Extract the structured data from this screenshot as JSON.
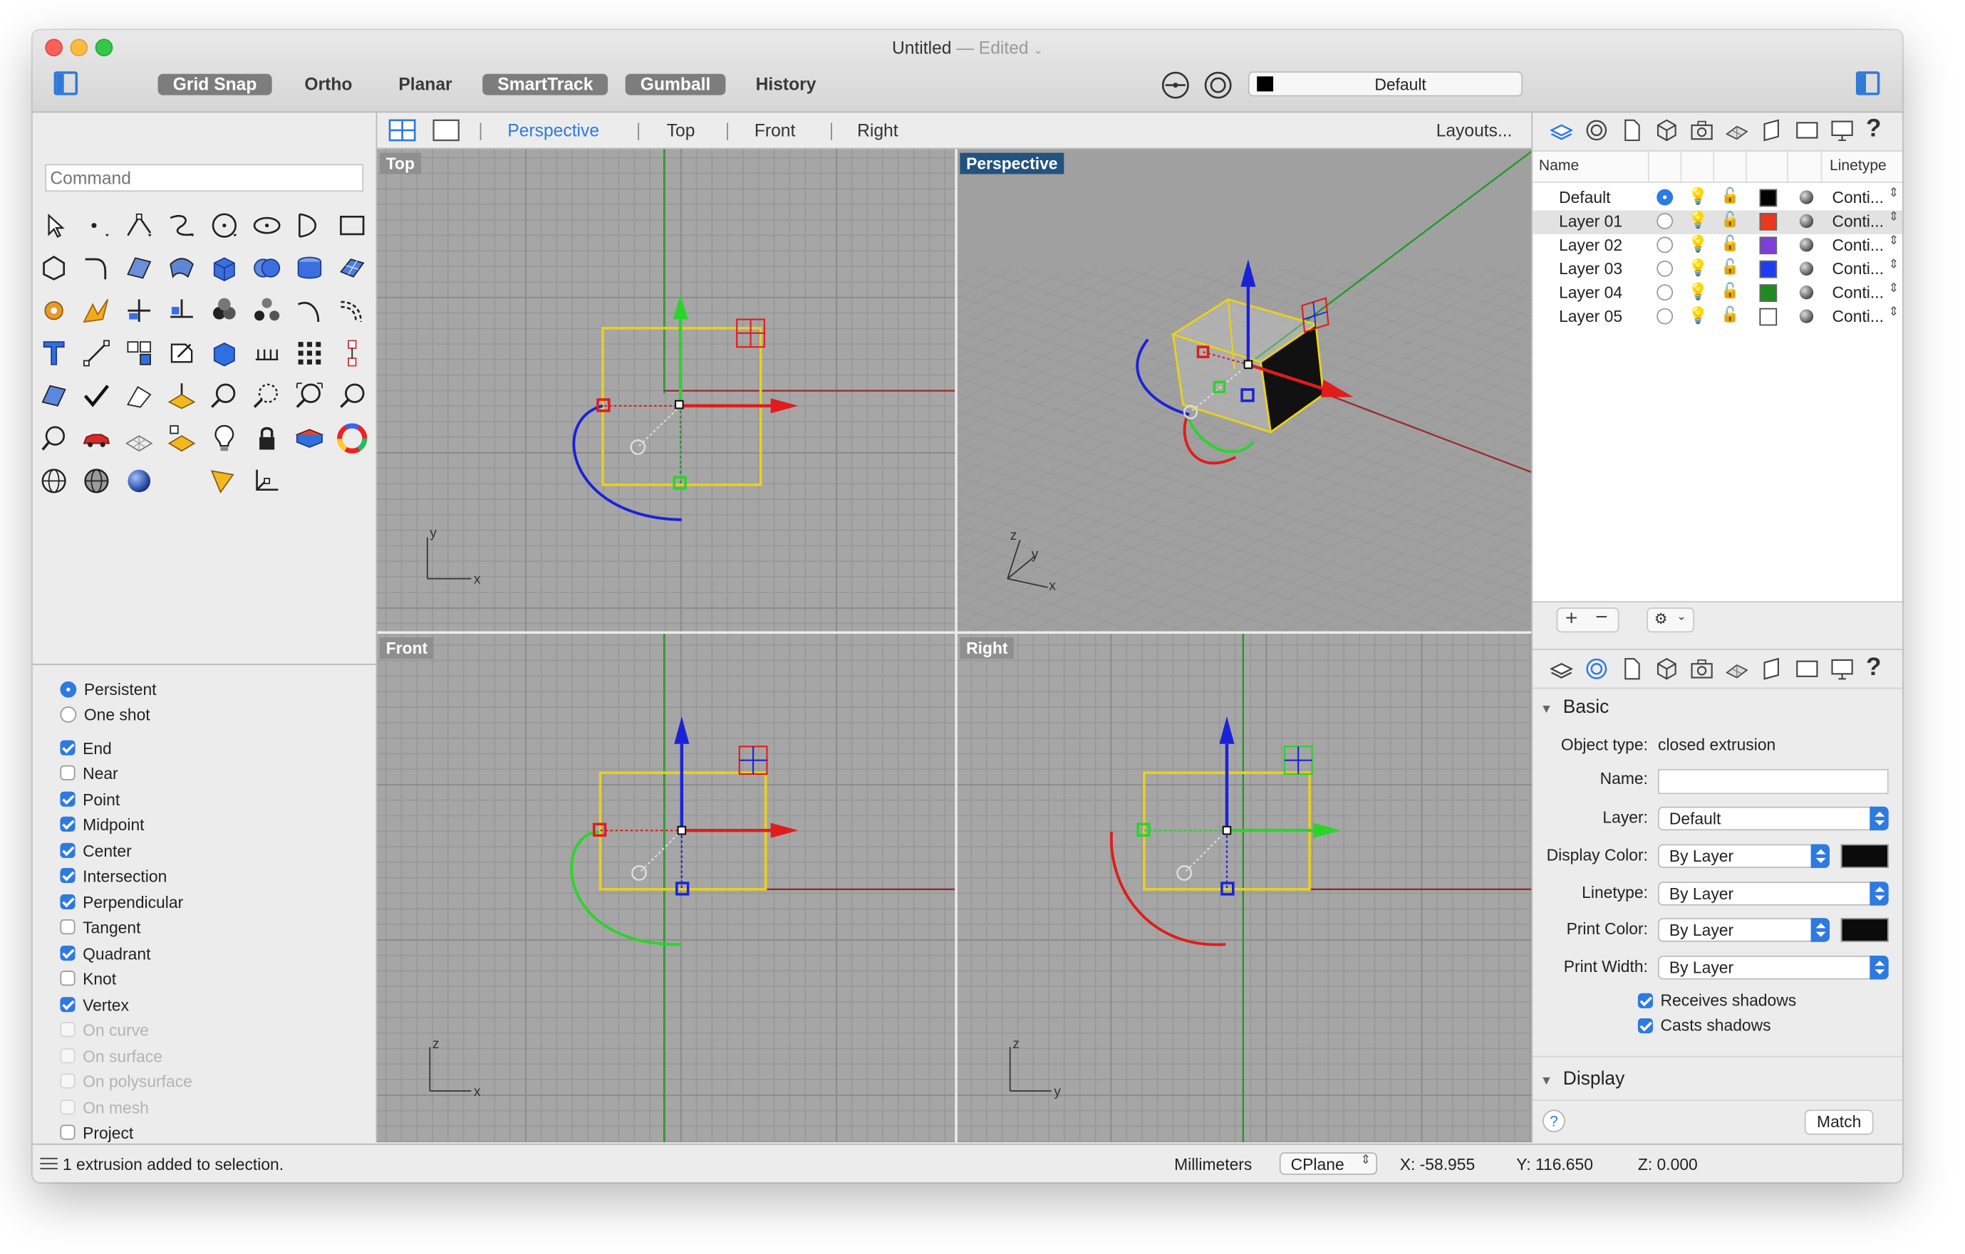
{
  "window": {
    "title": "Untitled",
    "edited": "— Edited"
  },
  "toolbar": {
    "grid_snap": "Grid Snap",
    "ortho": "Ortho",
    "planar": "Planar",
    "smarttrack": "SmartTrack",
    "gumball": "Gumball",
    "history": "History",
    "layer_default": "Default"
  },
  "command": {
    "placeholder": "Command"
  },
  "viewtabs": {
    "perspective": "Perspective",
    "top": "Top",
    "front": "Front",
    "right": "Right",
    "layouts": "Layouts..."
  },
  "viewports": {
    "top": {
      "label": "Top",
      "axis1": "y",
      "axis2": "x"
    },
    "perspective": {
      "label": "Perspective",
      "axis1": "z",
      "axis2": "y",
      "axis3": "x"
    },
    "front": {
      "label": "Front",
      "axis1": "z",
      "axis2": "x"
    },
    "right": {
      "label": "Right",
      "axis1": "z",
      "axis2": "y"
    }
  },
  "osnap": {
    "mode": [
      {
        "label": "Persistent",
        "selected": true
      },
      {
        "label": "One shot",
        "selected": false
      }
    ],
    "items": [
      {
        "label": "End",
        "checked": true,
        "enabled": true
      },
      {
        "label": "Near",
        "checked": false,
        "enabled": true
      },
      {
        "label": "Point",
        "checked": true,
        "enabled": true
      },
      {
        "label": "Midpoint",
        "checked": true,
        "enabled": true
      },
      {
        "label": "Center",
        "checked": true,
        "enabled": true
      },
      {
        "label": "Intersection",
        "checked": true,
        "enabled": true
      },
      {
        "label": "Perpendicular",
        "checked": true,
        "enabled": true
      },
      {
        "label": "Tangent",
        "checked": false,
        "enabled": true
      },
      {
        "label": "Quadrant",
        "checked": true,
        "enabled": true
      },
      {
        "label": "Knot",
        "checked": false,
        "enabled": true
      },
      {
        "label": "Vertex",
        "checked": true,
        "enabled": true
      },
      {
        "label": "On curve",
        "checked": false,
        "enabled": false
      },
      {
        "label": "On surface",
        "checked": false,
        "enabled": false
      },
      {
        "label": "On polysurface",
        "checked": false,
        "enabled": false
      },
      {
        "label": "On mesh",
        "checked": false,
        "enabled": false
      },
      {
        "label": "Project",
        "checked": false,
        "enabled": true
      }
    ]
  },
  "layers": {
    "header": {
      "name": "Name",
      "linetype": "Linetype"
    },
    "rows": [
      {
        "name": "Default",
        "current": true,
        "color": "#000000",
        "linetype": "Conti..."
      },
      {
        "name": "Layer 01",
        "current": false,
        "color": "#e8391f",
        "linetype": "Conti...",
        "selected": true
      },
      {
        "name": "Layer 02",
        "current": false,
        "color": "#7e3ed8",
        "linetype": "Conti..."
      },
      {
        "name": "Layer 03",
        "current": false,
        "color": "#1c3ef0",
        "linetype": "Conti..."
      },
      {
        "name": "Layer 04",
        "current": false,
        "color": "#1f8a1f",
        "linetype": "Conti..."
      },
      {
        "name": "Layer 05",
        "current": false,
        "color": "#ffffff",
        "linetype": "Conti..."
      }
    ]
  },
  "properties": {
    "section_basic": "Basic",
    "object_type_label": "Object type:",
    "object_type_value": "closed extrusion",
    "name_label": "Name:",
    "layer_label": "Layer:",
    "layer_value": "Default",
    "display_color_label": "Display Color:",
    "display_color_value": "By Layer",
    "linetype_label": "Linetype:",
    "linetype_value": "By Layer",
    "print_color_label": "Print Color:",
    "print_color_value": "By Layer",
    "print_width_label": "Print Width:",
    "print_width_value": "By Layer",
    "receives_shadows": "Receives shadows",
    "casts_shadows": "Casts shadows",
    "section_display": "Display",
    "match": "Match",
    "help": "?"
  },
  "status": {
    "message": "1 extrusion added to selection.",
    "units": "Millimeters",
    "cplane": "CPlane",
    "x": "X: -58.955",
    "y": "Y: 116.650",
    "z": "Z: 0.000"
  }
}
